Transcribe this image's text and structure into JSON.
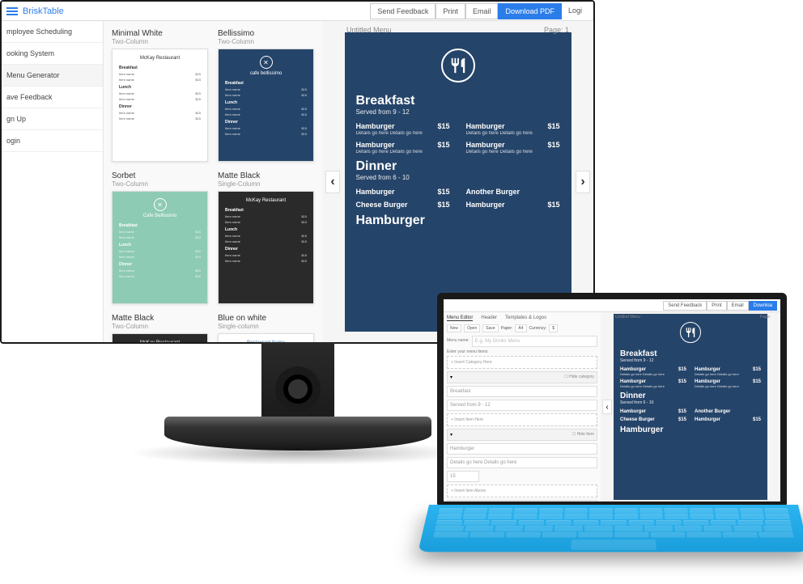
{
  "brand": "BriskTable",
  "topbar": {
    "send_feedback": "Send Feedback",
    "print": "Print",
    "email": "Email",
    "download": "Download PDF",
    "login": "Logi"
  },
  "sidebar": {
    "items": [
      "mployee Scheduling",
      "ooking System",
      "Menu Generator",
      "ave Feedback",
      "gn Up",
      "ogin"
    ]
  },
  "templates": [
    {
      "title": "Minimal White",
      "sub": "Two-Column",
      "style": "white",
      "header": "McKay Restaurant"
    },
    {
      "title": "Bellissimo",
      "sub": "Two-Column",
      "style": "blue",
      "header": "cafe bellissimo"
    },
    {
      "title": "Sorbet",
      "sub": "Two-Column",
      "style": "mint",
      "header": "Cafe Bellissimo"
    },
    {
      "title": "Matte Black",
      "sub": "Single-Column",
      "style": "black",
      "header": "McKay Restaurant"
    },
    {
      "title": "Matte Black",
      "sub": "Two-Column",
      "style": "black",
      "header": "McKay Restaurant"
    },
    {
      "title": "Blue on white",
      "sub": "Single-column",
      "style": "white",
      "header": "Restaurant Name"
    }
  ],
  "thumb_sections": [
    "Breakfast",
    "Lunch",
    "Dinner"
  ],
  "preview": {
    "title": "Untitled Menu",
    "page_label": "Page:",
    "page_num": "1",
    "sections": [
      {
        "title": "Breakfast",
        "sub": "Served from 9 - 12",
        "rows": [
          [
            {
              "name": "Hamburger",
              "price": "$15",
              "desc": "Details go here Details go here"
            },
            {
              "name": "Hamburger",
              "price": "$15",
              "desc": "Details go here Details go here"
            }
          ],
          [
            {
              "name": "Hamburger",
              "price": "$15",
              "desc": "Details go here Details go here"
            },
            {
              "name": "Hamburger",
              "price": "$15",
              "desc": "Details go here Details go here"
            }
          ]
        ]
      },
      {
        "title": "Dinner",
        "sub": "Served from 6 - 10",
        "rows": [
          [
            {
              "name": "Hamburger",
              "price": "$15",
              "desc": ""
            },
            {
              "name": "Another Burger",
              "price": "",
              "desc": ""
            }
          ],
          [
            {
              "name": "Cheese Burger",
              "price": "$15",
              "desc": ""
            },
            {
              "name": "Hamburger",
              "price": "$15",
              "desc": ""
            }
          ]
        ]
      },
      {
        "title": "Hamburger",
        "sub": "",
        "rows": []
      }
    ]
  },
  "laptop": {
    "topbar": {
      "send_feedback": "Send Feedback",
      "print": "Print",
      "email": "Email",
      "download": "Downloa"
    },
    "tabs": [
      "Menu Editor",
      "Header",
      "Templates & Logos"
    ],
    "toolbar": {
      "new": "New",
      "open": "Open",
      "save": "Save",
      "paper": "Paper:",
      "paper_val": "A4",
      "currency": "Currency:",
      "currency_val": "$"
    },
    "menu_name_label": "Menu name:",
    "menu_name_placeholder": "E.g. My Drinks Menu",
    "enter_items": "Enter your menu items:",
    "insert_category": "+ Insert Category Here",
    "hide_category": "Hide category",
    "category_name": "Breakfast",
    "category_sub": "Served from 9 - 12",
    "insert_item": "+ Insert Item Here",
    "hide_item": "Hide Item",
    "item_name": "Hamburger",
    "item_desc": "Details go here Details go here",
    "item_price": "15",
    "insert_item_above": "+ Insert Item Above",
    "preview_title": "Untitled Menu",
    "page_label": "Page:"
  }
}
